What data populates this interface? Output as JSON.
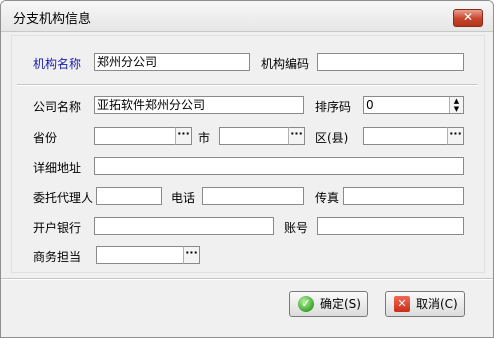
{
  "window": {
    "title": "分支机构信息",
    "close_icon_glyph": "✕"
  },
  "top": {
    "org_name_label": "机构名称",
    "org_name_value": "郑州分公司",
    "org_code_label": "机构编码",
    "org_code_value": ""
  },
  "form": {
    "company_name_label": "公司名称",
    "company_name_value": "亚拓软件郑州分公司",
    "sort_code_label": "排序码",
    "sort_code_value": "0",
    "province_label": "省份",
    "province_value": "",
    "city_label": "市",
    "city_value": "",
    "district_label": "区(县)",
    "district_value": "",
    "address_label": "详细地址",
    "address_value": "",
    "agent_label": "委托代理人",
    "agent_value": "",
    "phone_label": "电话",
    "phone_value": "",
    "fax_label": "传真",
    "fax_value": "",
    "bank_label": "开户银行",
    "bank_value": "",
    "account_label": "账号",
    "account_value": "",
    "business_label": "商务担当",
    "business_value": "",
    "ellipsis_glyph": "···",
    "spin_up_glyph": "▲",
    "spin_down_glyph": "▼"
  },
  "buttons": {
    "ok_label": "确定(S)",
    "cancel_label": "取消(C)",
    "ok_icon_glyph": "✓",
    "cancel_icon_glyph": "✕"
  },
  "colors": {
    "accent_label": "#1a1ab0",
    "close_button": "#c7432b"
  }
}
